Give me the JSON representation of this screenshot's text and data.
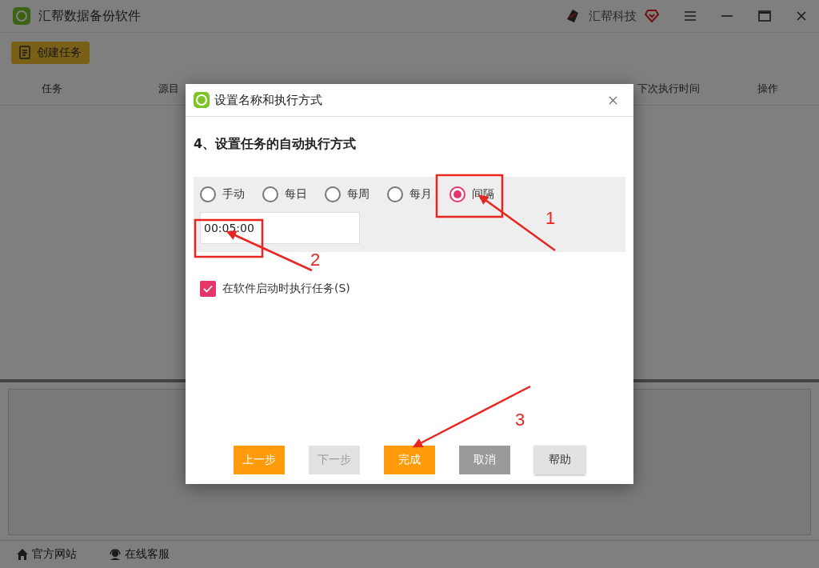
{
  "window": {
    "title": "汇帮数据备份软件",
    "brand": "汇帮科技"
  },
  "toolbar": {
    "create_button": "创建任务"
  },
  "table": {
    "columns": [
      "任务",
      "源目",
      "下次执行时间",
      "操作"
    ]
  },
  "footer": {
    "links": [
      {
        "label": "官方网站",
        "kind": "home"
      },
      {
        "label": "在线客服",
        "kind": "support"
      }
    ]
  },
  "dialog": {
    "title": "设置名称和执行方式",
    "heading": "4、设置任务的自动执行方式",
    "modes": [
      {
        "label": "手动",
        "selected": false
      },
      {
        "label": "每日",
        "selected": false
      },
      {
        "label": "每周",
        "selected": false
      },
      {
        "label": "每月",
        "selected": false
      },
      {
        "label": "间隔",
        "selected": true
      }
    ],
    "interval": {
      "value": "00:05:00"
    },
    "startup_option": {
      "label": "在软件启动时执行任务(S)",
      "checked": true
    },
    "buttons": [
      {
        "label": "上一步",
        "kind": "primary"
      },
      {
        "label": "下一步",
        "kind": "disabled"
      },
      {
        "label": "完成",
        "kind": "primary"
      },
      {
        "label": "取消",
        "kind": "gray"
      },
      {
        "label": "帮助",
        "kind": "light"
      }
    ]
  },
  "annotations": [
    {
      "label": "1"
    },
    {
      "label": "2"
    },
    {
      "label": "3"
    }
  ]
}
